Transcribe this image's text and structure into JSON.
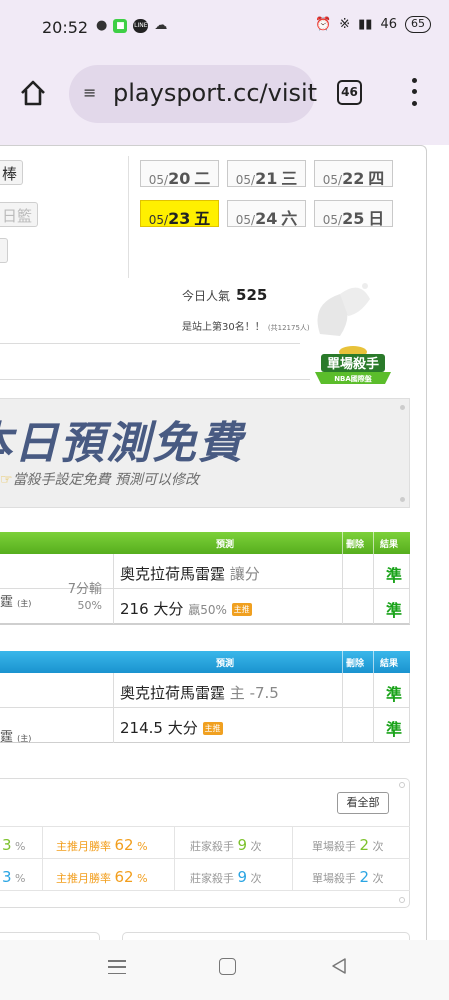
{
  "status_bar": {
    "time": "20:52",
    "signal_text": "46",
    "battery": "65",
    "left_icons": [
      "location-icon",
      "app-icon",
      "line-icon",
      "cloud-icon"
    ],
    "right_icons": [
      "alarm-icon",
      "bluetooth-icon",
      "signal-icon"
    ]
  },
  "browser": {
    "url": "playsport.cc/visit",
    "tabs_count": "46",
    "home_icon": "home-icon",
    "more_icon": "more-vertical-icon"
  },
  "sports_tabs": [
    {
      "label": "棒",
      "faded": false
    },
    {
      "label": "日籃",
      "faded": true
    },
    {
      "label": "",
      "faded": false
    }
  ],
  "dates": [
    {
      "prefix": "05/",
      "day": "20",
      "weekday": "二",
      "active": false
    },
    {
      "prefix": "05/",
      "day": "21",
      "weekday": "三",
      "active": false
    },
    {
      "prefix": "05/",
      "day": "22",
      "weekday": "四",
      "active": false
    },
    {
      "prefix": "05/",
      "day": "23",
      "weekday": "五",
      "active": true
    },
    {
      "prefix": "05/",
      "day": "24",
      "weekday": "六",
      "active": false
    },
    {
      "prefix": "05/",
      "day": "25",
      "weekday": "日",
      "active": false
    }
  ],
  "popularity": {
    "label": "今日人氣",
    "value": "525"
  },
  "rank": {
    "text": "是站上第30名！！",
    "note": "(共12175人)"
  },
  "promo_badge": {
    "line1": "單場殺手",
    "line2": "NBA國際盤"
  },
  "banner": {
    "title": "本日預測免費",
    "subtitle": "當殺手設定免費 預測可以修改"
  },
  "table_green": {
    "headers": {
      "prediction": "預測",
      "delete": "刪除",
      "result": "結果"
    },
    "team": "霆",
    "team_tag": "(主)",
    "spread_top": "7分輸",
    "spread_bottom": "50%",
    "rows": [
      {
        "main": "奧克拉荷馬雷霆",
        "extra": "讓分",
        "badge": "",
        "result": "準"
      },
      {
        "main": "216 大分",
        "extra": "贏50%",
        "badge": "主推",
        "result": "準"
      }
    ]
  },
  "table_blue": {
    "headers": {
      "prediction": "預測",
      "delete": "刪除",
      "result": "結果"
    },
    "team": "霆",
    "team_tag": "(主)",
    "rows": [
      {
        "main": "奧克拉荷馬雷霆",
        "extra": "主 -7.5",
        "badge": "",
        "result": "準"
      },
      {
        "main": "214.5 大分",
        "extra": "",
        "badge": "主推",
        "result": "準"
      }
    ]
  },
  "stats": {
    "view_all": "看全部",
    "rows": [
      {
        "partial": "3",
        "partial_unit": "%",
        "main_label": "主推月勝率",
        "main_value": "62",
        "main_unit": "%",
        "banker_label": "莊家殺手",
        "banker_value": "9",
        "banker_unit": "次",
        "single_label": "單場殺手",
        "single_value": "2",
        "single_unit": "次",
        "color": "green"
      },
      {
        "partial": "3",
        "partial_unit": "%",
        "main_label": "主推月勝率",
        "main_value": "62",
        "main_unit": "%",
        "banker_label": "莊家殺手",
        "banker_value": "9",
        "banker_unit": "次",
        "single_label": "單場殺手",
        "single_value": "2",
        "single_unit": "次",
        "color": "blue"
      }
    ]
  },
  "nav": {
    "menu_icon": "recent-apps-icon",
    "home_icon": "home-square-icon",
    "back_icon": "back-triangle-icon"
  }
}
